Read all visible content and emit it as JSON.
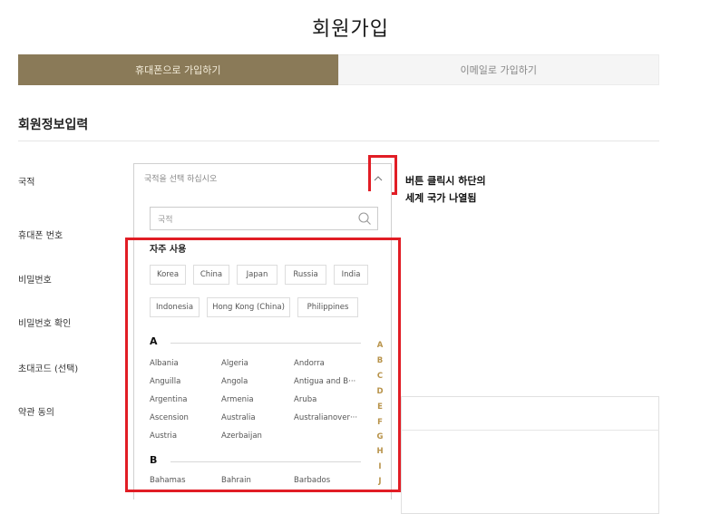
{
  "page": {
    "title": "회원가입"
  },
  "tabs": [
    {
      "label": "휴대폰으로 가입하기",
      "active": true
    },
    {
      "label": "이메일로 가입하기",
      "active": false
    }
  ],
  "section": {
    "title": "회원정보입력"
  },
  "labels": {
    "nationality": "국적",
    "phone": "휴대폰 번호",
    "password": "비밀번호",
    "password_confirm": "비밀번호 확인",
    "invite_code": "초대코드 (선택)",
    "terms": "약관 동의"
  },
  "country_select": {
    "placeholder": "국적을 선택 하십시오"
  },
  "annotation": {
    "line1": "버튼 클릭시 하단의",
    "line2": "세계 국가 나열됨"
  },
  "dropdown": {
    "search_placeholder": "국적",
    "frequent_title": "자주 사용",
    "frequent": [
      "Korea",
      "China",
      "Japan",
      "Russia",
      "India",
      "Indonesia",
      "Hong Kong (China)",
      "Philippines"
    ],
    "groups": [
      {
        "letter": "A",
        "countries": [
          "Albania",
          "Algeria",
          "Andorra",
          "Anguilla",
          "Angola",
          "Antigua and B···",
          "Argentina",
          "Armenia",
          "Aruba",
          "Ascension",
          "Australia",
          "Australianover···",
          "Austria",
          "Azerbaijan"
        ]
      },
      {
        "letter": "B",
        "countries": [
          "Bahamas",
          "Bahrain",
          "Barbados"
        ]
      }
    ],
    "alpha_index": [
      "A",
      "B",
      "C",
      "D",
      "E",
      "F",
      "G",
      "H",
      "I",
      "J"
    ]
  },
  "colors": {
    "accent": "#8a7a58",
    "highlight": "#e11d25",
    "index": "#b8934a"
  }
}
